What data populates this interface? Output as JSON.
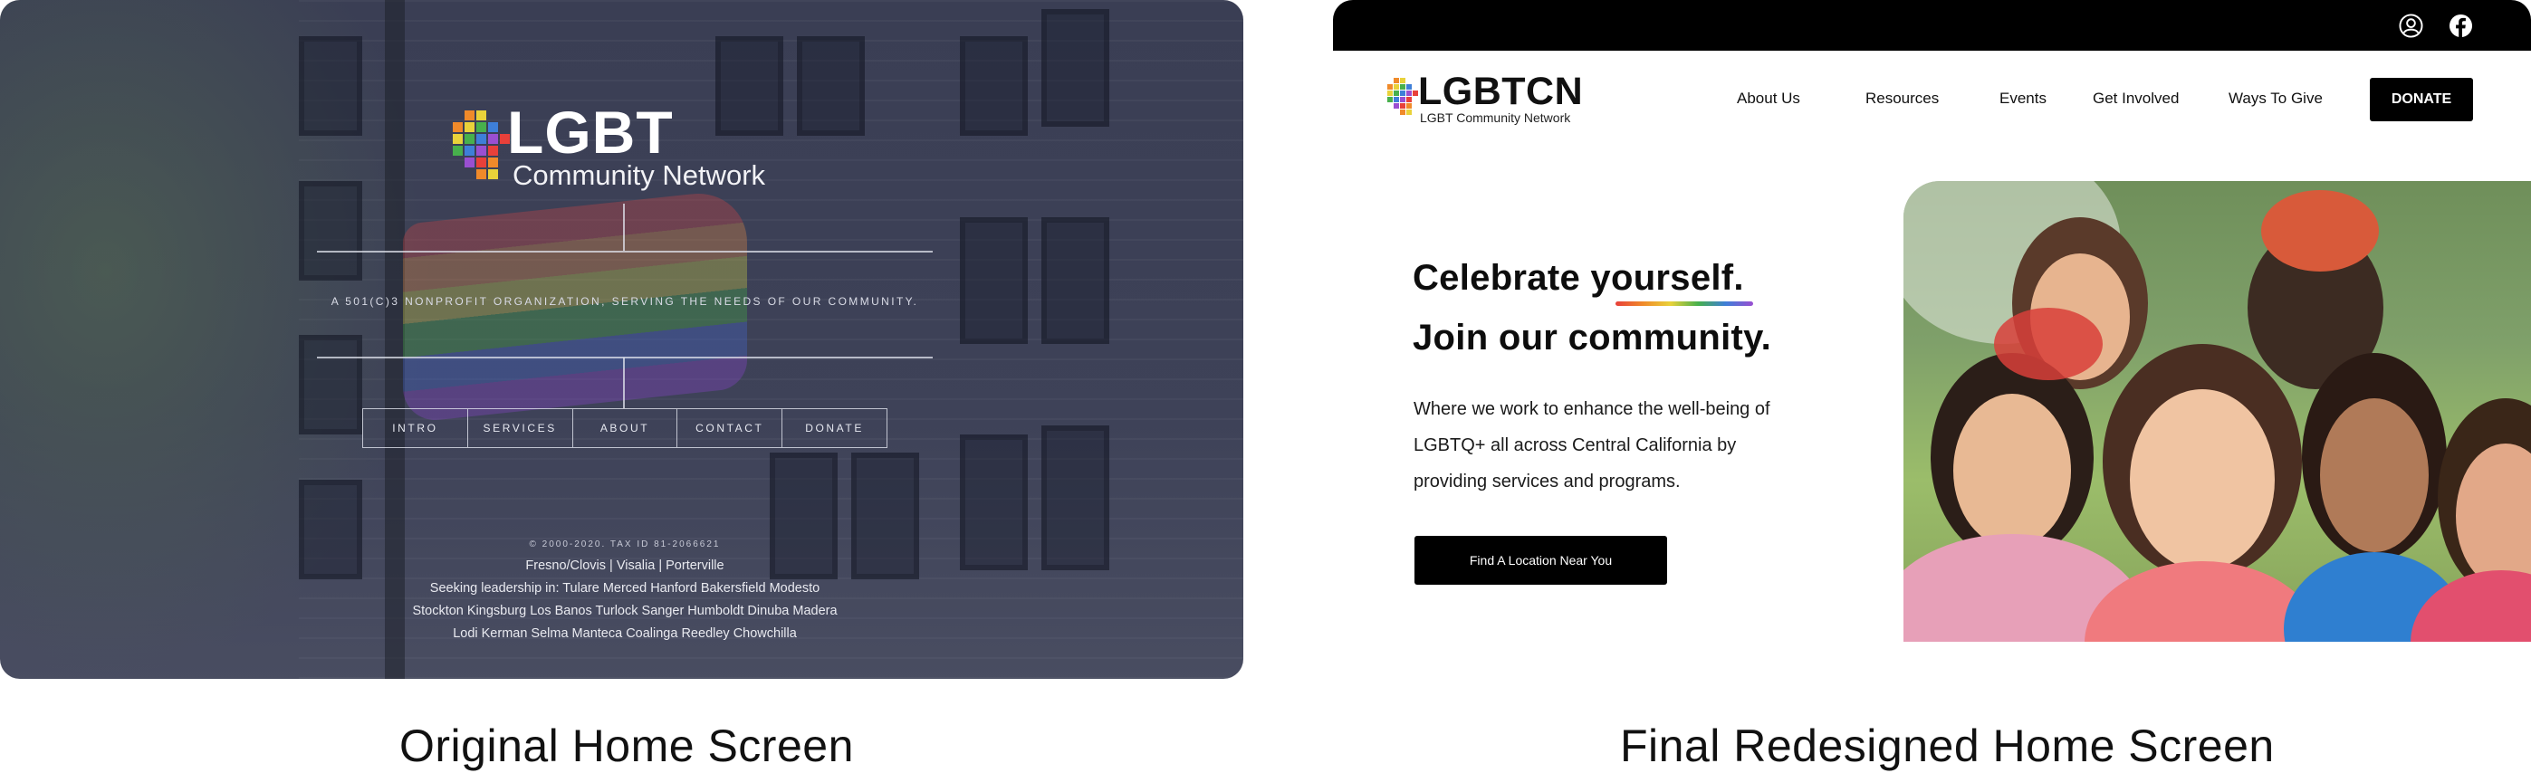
{
  "original": {
    "logo": {
      "lgbt": "LGBT",
      "network": "Community Network"
    },
    "tagline": "A 501(C)3 NONPROFIT ORGANIZATION, SERVING THE NEEDS OF OUR COMMUNITY.",
    "nav": [
      "INTRO",
      "SERVICES",
      "ABOUT",
      "CONTACT",
      "DONATE"
    ],
    "footer": {
      "copyright": "© 2000-2020. TAX ID 81-2066621",
      "cities": "Fresno/Clovis | Visalia | Porterville",
      "leadership_line1": "Seeking leadership in: Tulare Merced Hanford Bakersfield Modesto",
      "leadership_line2": "Stockton Kingsburg Los Banos Turlock Sanger Humboldt Dinuba Madera",
      "leadership_line3": "Lodi Kerman Selma Manteca Coalinga Reedley Chowchilla"
    }
  },
  "redesign": {
    "logo": {
      "title": "LGBTCN",
      "subtitle": "LGBT Community Network"
    },
    "nav": [
      "About Us",
      "Resources",
      "Events",
      "Get Involved",
      "Ways To Give"
    ],
    "donate_label": "DONATE",
    "hero": {
      "line1_prefix": "Celebrate ",
      "line1_emph": "yourself.",
      "line2": "Join our community.",
      "body": "Where we work to enhance the well-being of LGBTQ+ all across Central California by providing services and programs.",
      "cta": "Find A Location Near You"
    },
    "topbar_icons": [
      "user-icon",
      "facebook-icon"
    ]
  },
  "captions": {
    "left": "Original Home Screen",
    "right": "Final Redesigned Home Screen"
  },
  "colors": {
    "rainbow": [
      "#e8403a",
      "#f08a2a",
      "#e9d23a",
      "#47b04c",
      "#3e7fd8",
      "#9a4fd1"
    ],
    "black": "#000000"
  }
}
